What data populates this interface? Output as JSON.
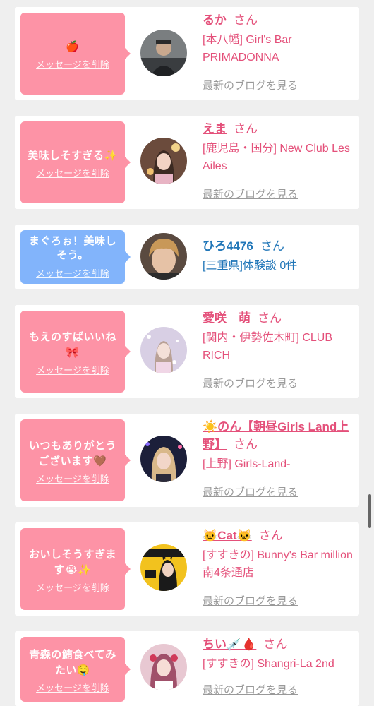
{
  "delete_label": "メッセージを削除",
  "blog_label": "最新のブログを見る",
  "san_label": "さん",
  "cards": [
    {
      "message": "🍎",
      "name": "るか",
      "shop": "[本八幡] Girl's Bar PRIMADONNA",
      "has_blog": true,
      "color": "pink"
    },
    {
      "message": "美味しそすぎる✨",
      "name": "えま",
      "shop": "[鹿児島・国分] New Club Les Ailes",
      "has_blog": true,
      "color": "pink"
    },
    {
      "message": "まぐろぉ！美味しそう。",
      "name": "ひろ4476",
      "shop": "[三重県]体験談 0件",
      "has_blog": false,
      "color": "blue"
    },
    {
      "message": "もえのすばいいね🎀",
      "name": "愛咲　萌",
      "shop": "[関内・伊勢佐木町] CLUB RICH",
      "has_blog": true,
      "color": "pink"
    },
    {
      "message": "いつもありがとうございます🤎",
      "name": "☀️のん【朝昼Girls Land上野】",
      "shop": "[上野] Girls-Land-",
      "has_blog": true,
      "color": "pink"
    },
    {
      "message": "おいしそうすぎます😭✨",
      "name": "🐱Cat🐱",
      "shop": "[すすきの] Bunny's Bar million 南4条通店",
      "has_blog": true,
      "color": "pink"
    },
    {
      "message": "青森の鮪食べてみたい🤤",
      "name": "ちい💉🩸",
      "shop": "[すすきの] Shangri-La 2nd",
      "has_blog": true,
      "color": "pink"
    }
  ],
  "colors": {
    "pink_bubble": "#fd93a6",
    "blue_bubble": "#82b4fb",
    "pink_text": "#e4507a",
    "blue_text": "#2076b8",
    "page_bg": "#efefef"
  }
}
